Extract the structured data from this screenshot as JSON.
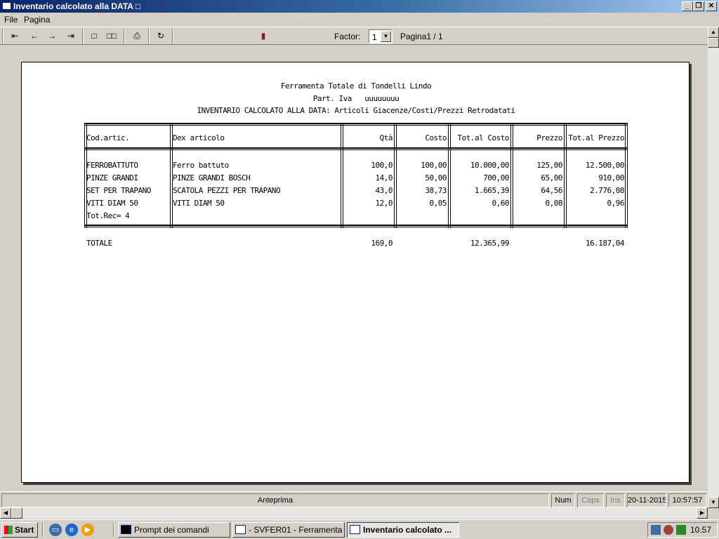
{
  "window": {
    "title": "Inventario calcolato alla DATA □",
    "min": "_",
    "max": "❐",
    "close": "✕"
  },
  "menu": {
    "file": "File",
    "pagina": "Pagina"
  },
  "toolbar": {
    "first": "⇤",
    "prev": "←",
    "next": "→",
    "last": "⇥",
    "single_page": "□",
    "two_pages": "□□",
    "print": "⎙",
    "export": "↻",
    "exit": "▮",
    "factor_label": "Factor:",
    "factor_value": "1",
    "page_info": "Pagina1 / 1"
  },
  "report": {
    "company": "Ferramenta Totale di Tondelli Lindo",
    "vat_label": "Part. Iva",
    "vat_value": "uuuuuuuu",
    "heading": "INVENTARIO CALCOLATO ALLA DATA: Articoli Giacenze/Costi/Prezzi Retrodatati",
    "columns": [
      "Cod.artic.",
      "Dex articolo",
      "Qtà",
      "Costo",
      "Tot.al Costo",
      "Prezzo",
      "Tot.al Prezzo"
    ],
    "rows": [
      [
        "FERROBATTUTO",
        "Ferro battuto",
        "100,0",
        "100,00",
        "10.000,00",
        "125,00",
        "12.500,00"
      ],
      [
        "PINZE GRANDI",
        "PINZE GRANDI BOSCH",
        "14,0",
        "50,00",
        "700,00",
        "65,00",
        "910,00"
      ],
      [
        "SET PER TRAPANO",
        "SCATOLA PEZZI PER TRAPANO",
        "43,0",
        "38,73",
        "1.665,39",
        "64,56",
        "2.776,08"
      ],
      [
        "VITI DIAM 50",
        "VITI DIAM 50",
        "12,0",
        "0,05",
        "0,60",
        "0,08",
        "0,96"
      ]
    ],
    "tot_rec": "Tot.Rec= 4",
    "totals": {
      "label": "TOTALE",
      "qty": "169,0",
      "tot_costo": "12.365,99",
      "tot_prezzo": "16.187,04"
    }
  },
  "status": {
    "label": "Anteprima",
    "num": "Num",
    "caps": "Caps",
    "ins": "Ins",
    "date": "20-11-2015",
    "time": "10:57:57"
  },
  "taskbar": {
    "start": "Start",
    "tasks": [
      "Prompt dei comandi",
      "- SVFER01 - Ferramenta ...",
      "Inventario calcolato ..."
    ],
    "clock": "10.57"
  }
}
